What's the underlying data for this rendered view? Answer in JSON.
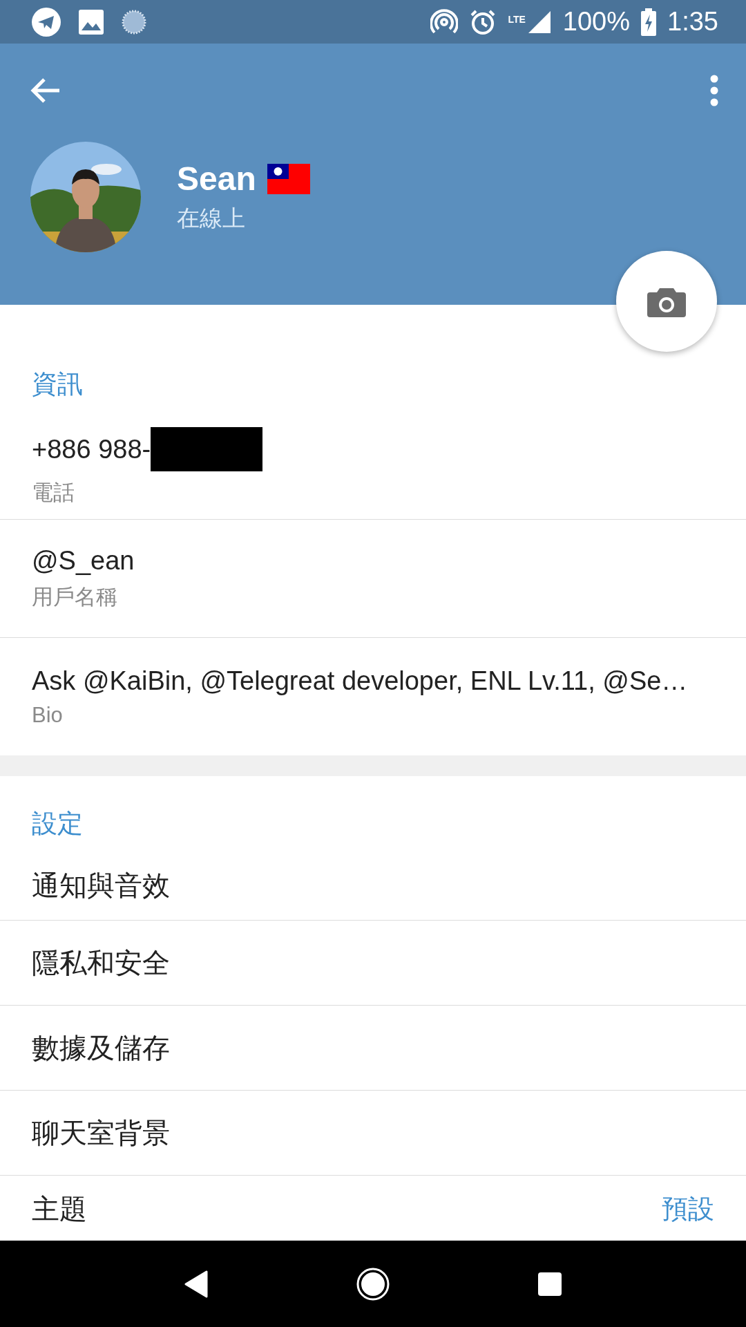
{
  "status_bar": {
    "network": "LTE",
    "battery": "100%",
    "time": "1:35"
  },
  "header": {
    "name": "Sean",
    "status": "在線上"
  },
  "info": {
    "title": "資訊",
    "rows": [
      {
        "value": "+886 988-",
        "label": "電話",
        "redacted": true
      },
      {
        "value": "@S_ean",
        "label": "用戶名稱",
        "redacted": false
      },
      {
        "value": "Ask @KaiBin, @Telegreat developer, ENL Lv.11, @Se…",
        "label": "Bio",
        "redacted": false
      }
    ]
  },
  "settings": {
    "title": "設定",
    "rows": [
      {
        "label": "通知與音效"
      },
      {
        "label": "隱私和安全"
      },
      {
        "label": "數據及儲存"
      },
      {
        "label": "聊天室背景"
      },
      {
        "label": "主題",
        "value": "預設"
      }
    ]
  }
}
